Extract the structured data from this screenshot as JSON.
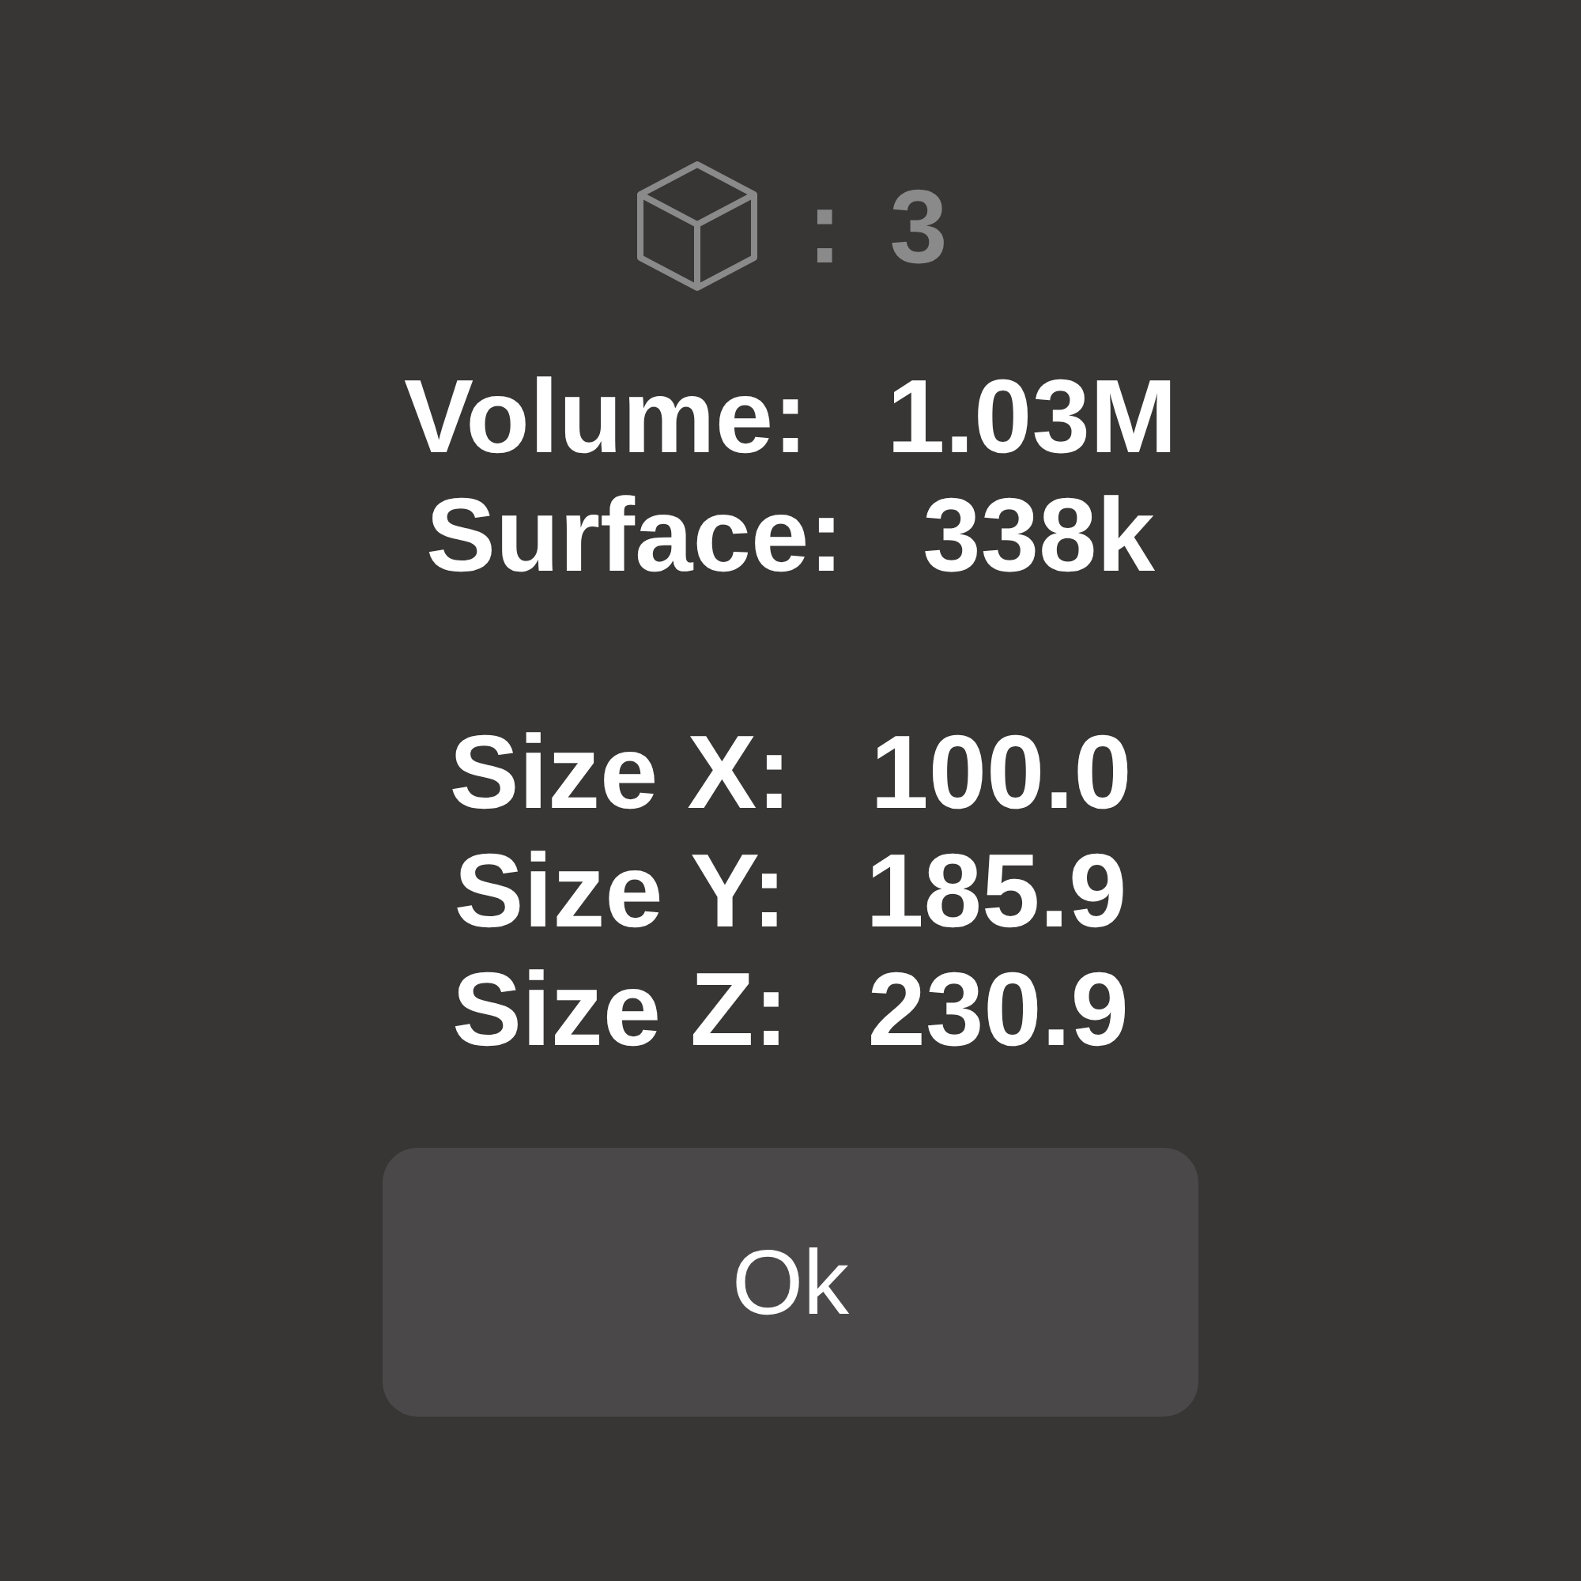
{
  "header": {
    "separator": ":",
    "count": "3"
  },
  "stats": [
    {
      "label": "Volume:",
      "value": "1.03M"
    },
    {
      "label": "Surface:",
      "value": "338k"
    }
  ],
  "sizes": [
    {
      "label": "Size X:",
      "value": "100.0"
    },
    {
      "label": "Size Y:",
      "value": "185.9"
    },
    {
      "label": "Size Z:",
      "value": "230.9"
    }
  ],
  "button": {
    "label": "Ok"
  }
}
